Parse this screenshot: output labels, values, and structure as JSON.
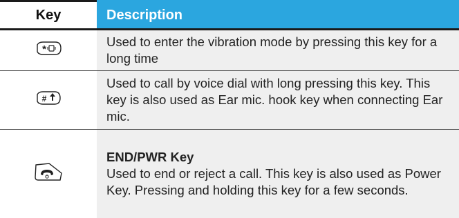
{
  "table": {
    "headers": {
      "key": "Key",
      "description": "Description"
    },
    "rows": [
      {
        "key_icon": "star-vibrate-key-icon",
        "key_glyph": "*",
        "title": "",
        "description": "Used to enter the vibration mode by pressing this key for a long time"
      },
      {
        "key_icon": "hash-voice-key-icon",
        "key_glyph": "#",
        "title": "",
        "description": "Used to call by voice dial with long pressing this key. This key is also used as Ear mic. hook key when connecting Ear mic."
      },
      {
        "key_icon": "end-power-key-icon",
        "key_glyph": "",
        "title": "END/PWR Key",
        "description": "Used to end or reject a call. This key is also used as Power Key. Pressing and holding this key for a few seconds."
      }
    ]
  },
  "colors": {
    "header_accent": "#2ba6df",
    "row_background": "#efefef",
    "rule": "#1a1a1a"
  }
}
